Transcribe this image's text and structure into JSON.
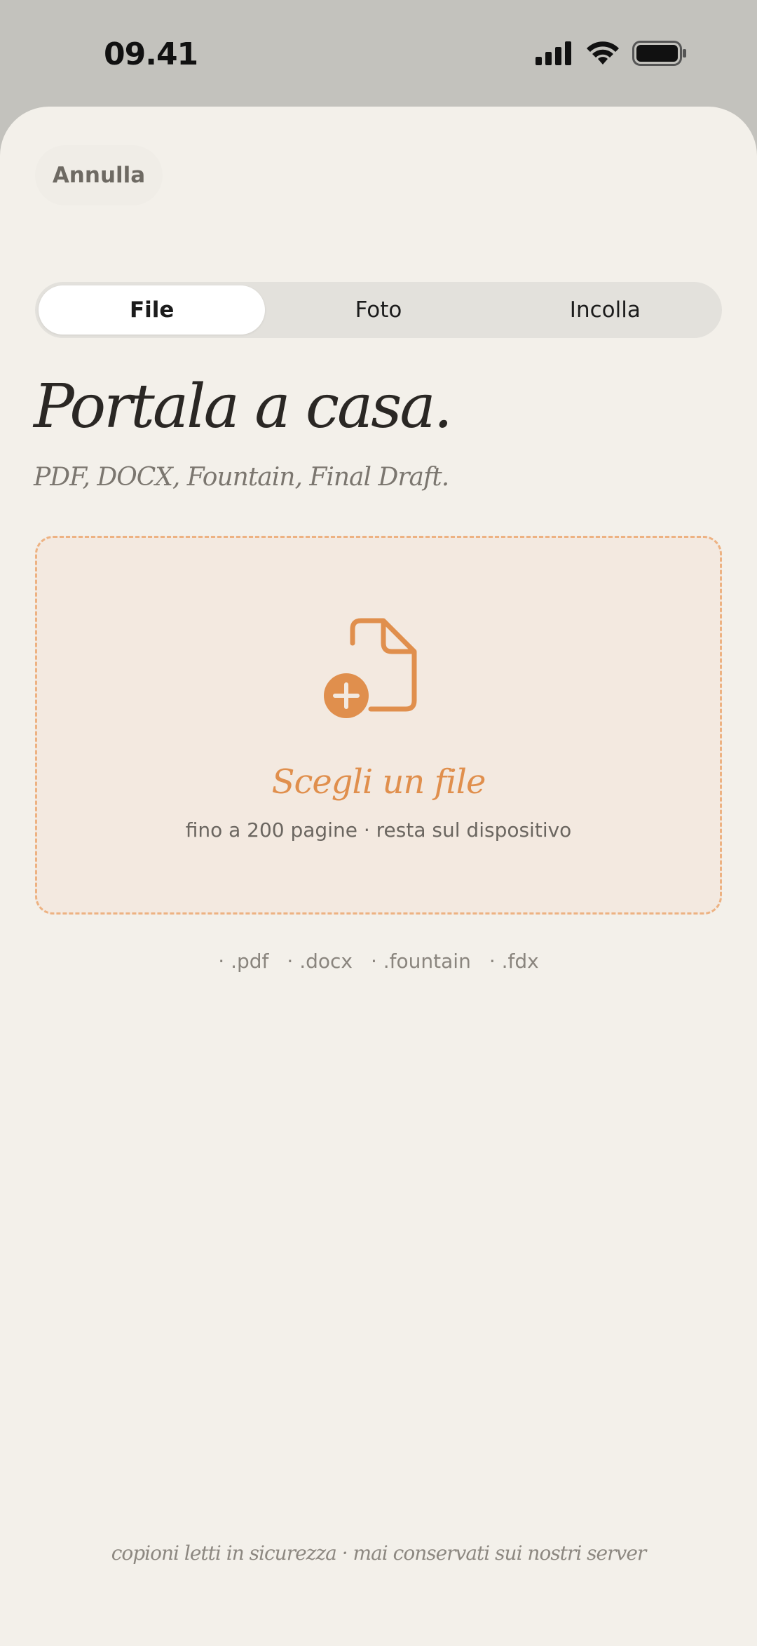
{
  "status_bar": {
    "time": "09.41",
    "icons": [
      "cellular-signal-icon",
      "wifi-icon",
      "battery-icon"
    ]
  },
  "header": {
    "cancel_label": "Annulla"
  },
  "tabs": [
    {
      "label": "File",
      "selected": true
    },
    {
      "label": "Foto",
      "selected": false
    },
    {
      "label": "Incolla",
      "selected": false
    }
  ],
  "main": {
    "title": "Portala a casa.",
    "subtitle": "PDF, DOCX, Fountain, Final Draft."
  },
  "dropzone": {
    "icon": "file-add-icon",
    "title": "Scegli un file",
    "subtitle": "fino a 200 pagine · resta sul dispositivo"
  },
  "formats": [
    "· .pdf",
    "· .docx",
    "· .fountain",
    "· .fdx"
  ],
  "footer": {
    "note": "copioni letti in sicurezza · mai conservati sui nostri server"
  },
  "colors": {
    "accent": "#e08f4d",
    "sheet_background": "#f3f0ea",
    "backdrop": "#c3c2bd"
  }
}
